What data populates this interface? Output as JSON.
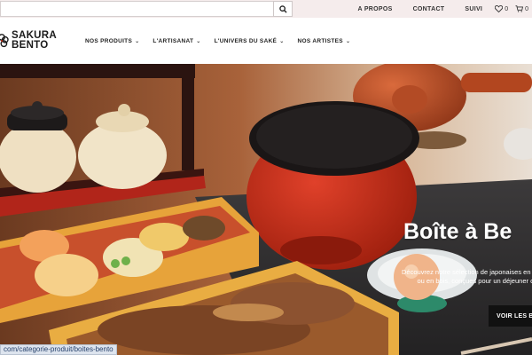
{
  "search": {
    "placeholder": "",
    "value": ""
  },
  "topbar": {
    "links": [
      "A PROPOS",
      "CONTACT",
      "SUIVI"
    ],
    "wishlist_count": "0",
    "cart_count": "0"
  },
  "logo": {
    "line1": "SAKURA",
    "line2": "BENTO"
  },
  "nav": {
    "items": [
      "NOS PRODUITS",
      "L'ARTISANAT",
      "L'UNIVERS DU SAKÉ",
      "NOS ARTISTES"
    ]
  },
  "hero": {
    "title": "Boîte à Be",
    "text": "Découvrez notre sélection de japonaises en résine ou en bois, conçues pour un déjeuner cl",
    "button": "VOIR LES B"
  },
  "status_url": "com/categorie-produit/boites-bento",
  "icons": [
    "search-icon",
    "heart-icon",
    "cart-icon",
    "chevron-down-icon",
    "sakura-logo-icon"
  ],
  "colors": {
    "topbar_bg": "#f5ecec",
    "button_bg": "#111111",
    "accent_red": "#c62a14"
  }
}
